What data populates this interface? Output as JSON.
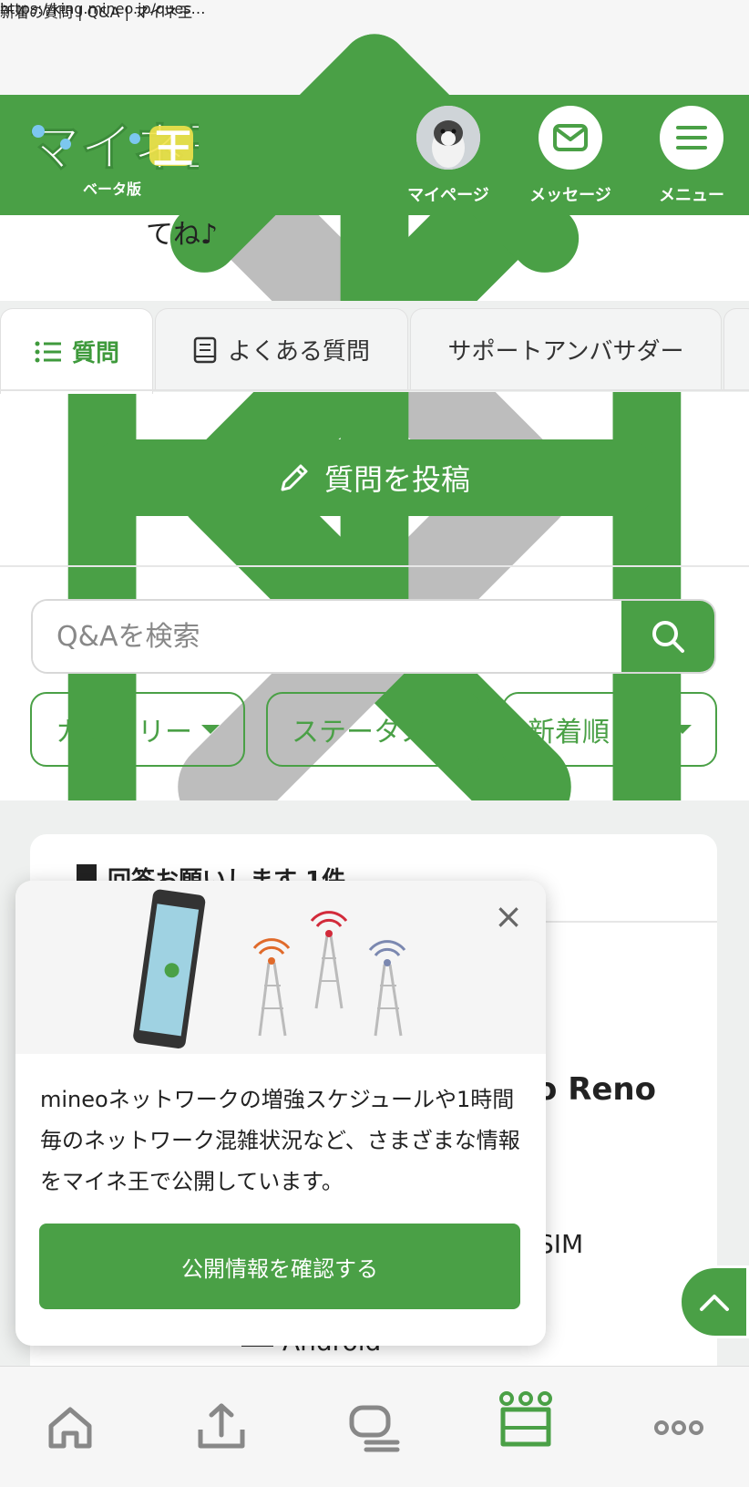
{
  "browser": {
    "page_title": "新着の質問 | Q&A | マイネ王",
    "url": "https://king.mineo.jp/ques…"
  },
  "header": {
    "logo_text": "マイネ王",
    "logo_sub": "ベータ版",
    "mypage_label": "マイページ",
    "message_label": "メッセージ",
    "menu_label": "メニュー"
  },
  "content": {
    "snippet": "てね♪"
  },
  "tabs": [
    {
      "label": "質問",
      "active": true
    },
    {
      "label": "よくある質問",
      "active": false
    },
    {
      "label": "サポートアンバサダー",
      "active": false
    }
  ],
  "post_button": "質問を投稿",
  "search": {
    "placeholder": "Q&Aを検索"
  },
  "filters": {
    "category": "カテゴリー",
    "status": "ステータス",
    "sort": "新着順"
  },
  "card": {
    "title": "回答お願いします 1件",
    "partial_title": "o Reno",
    "partial_sim": "SIM",
    "partial_os": "Android"
  },
  "popup": {
    "text": "mineoネットワークの増強スケジュールや1時間毎のネットワーク混雑状況など、さまざまな情報をマイネ王で公開しています。",
    "button": "公開情報を確認する"
  },
  "colors": {
    "brand_green": "#4aa046",
    "background_gray": "#eef0ef"
  },
  "bottom_nav": [
    "home-icon",
    "upload-icon",
    "chat-icon",
    "crown-icon",
    "more-icon"
  ]
}
